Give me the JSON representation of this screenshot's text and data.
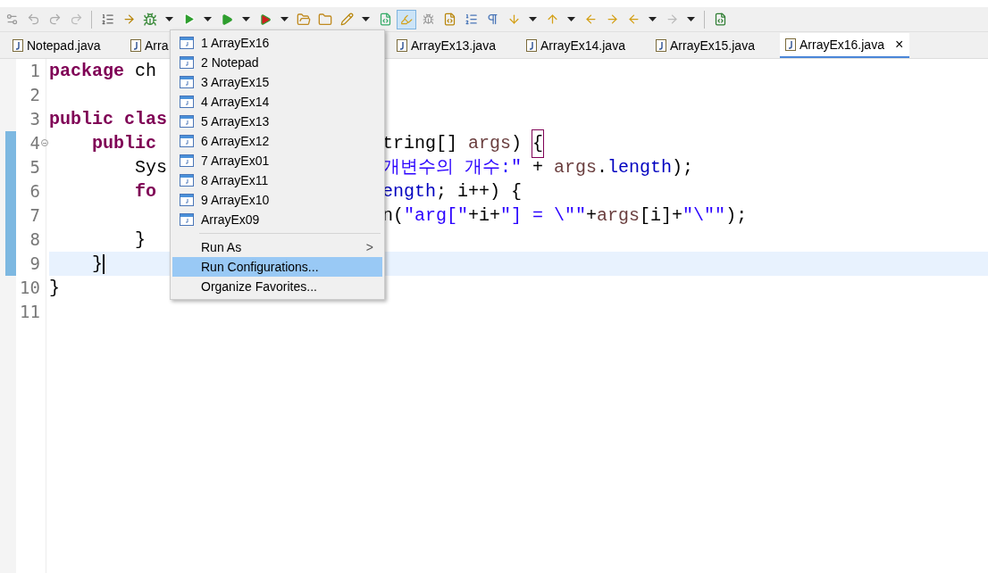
{
  "tabs": [
    {
      "label": "Notepad.java",
      "selected": false
    },
    {
      "label": "Arra",
      "selected": false
    },
    {
      "label": "ArrayEx13.java",
      "selected": false
    },
    {
      "label": "ArrayEx14.java",
      "selected": false
    },
    {
      "label": "ArrayEx15.java",
      "selected": false
    },
    {
      "label": "ArrayEx16.java",
      "selected": true,
      "close": "×"
    }
  ],
  "editor": {
    "lines": [
      {
        "number": "1",
        "marked": false,
        "current": false,
        "foldable": false,
        "left": [
          {
            "kind": "keyword",
            "text": "package"
          },
          {
            "kind": "plain",
            "text": " ch"
          }
        ]
      },
      {
        "number": "2",
        "marked": false,
        "current": false,
        "foldable": false
      },
      {
        "number": "3",
        "marked": false,
        "current": false,
        "foldable": false,
        "left": [
          {
            "kind": "keyword",
            "text": "public "
          },
          {
            "kind": "keyword",
            "text": "clas"
          }
        ]
      },
      {
        "number": "4",
        "marked": true,
        "current": false,
        "foldable": true,
        "left": [
          {
            "kind": "keyword",
            "text": "    public"
          }
        ],
        "right": [
          {
            "kind": "plain",
            "text": "tring[] "
          },
          {
            "kind": "variable",
            "text": "args"
          },
          {
            "kind": "plain",
            "text": ") "
          },
          {
            "kind": "plain",
            "text": "{",
            "boxed": true
          }
        ]
      },
      {
        "number": "5",
        "marked": true,
        "current": false,
        "foldable": false,
        "left": [
          {
            "kind": "plain",
            "text": "        Sys"
          }
        ],
        "right": [
          {
            "kind": "string",
            "text": "개변수의 개수:\""
          },
          {
            "kind": "plain",
            "text": " + "
          },
          {
            "kind": "variable",
            "text": "args"
          },
          {
            "kind": "plain",
            "text": "."
          },
          {
            "kind": "field",
            "text": "length"
          },
          {
            "kind": "plain",
            "text": ");"
          }
        ]
      },
      {
        "number": "6",
        "marked": true,
        "current": false,
        "foldable": false,
        "left": [
          {
            "kind": "keyword",
            "text": "        fo"
          }
        ],
        "right": [
          {
            "kind": "field",
            "text": "ength"
          },
          {
            "kind": "plain",
            "text": "; i++) {"
          }
        ]
      },
      {
        "number": "7",
        "marked": true,
        "current": false,
        "foldable": false,
        "right": [
          {
            "kind": "plain",
            "text": "n("
          },
          {
            "kind": "string",
            "text": "\"arg[\""
          },
          {
            "kind": "plain",
            "text": "+i+"
          },
          {
            "kind": "string",
            "text": "\"] = \\\"\""
          },
          {
            "kind": "plain",
            "text": "+"
          },
          {
            "kind": "variable",
            "text": "args"
          },
          {
            "kind": "plain",
            "text": "[i]+"
          },
          {
            "kind": "string",
            "text": "\"\\\"\""
          },
          {
            "kind": "plain",
            "text": ");"
          }
        ]
      },
      {
        "number": "8",
        "marked": true,
        "current": false,
        "foldable": false,
        "left": [
          {
            "kind": "plain",
            "text": "        }"
          }
        ]
      },
      {
        "number": "9",
        "marked": true,
        "current": true,
        "foldable": false,
        "left": [
          {
            "kind": "plain",
            "text": "    }"
          }
        ]
      },
      {
        "number": "10",
        "marked": false,
        "current": false,
        "foldable": false,
        "left": [
          {
            "kind": "plain",
            "text": "}"
          }
        ]
      },
      {
        "number": "11",
        "marked": false,
        "current": false,
        "foldable": false
      }
    ]
  },
  "menu": {
    "items": [
      {
        "kind": "launch",
        "label": "1 ArrayEx16",
        "selected": false
      },
      {
        "kind": "launch",
        "label": "2 Notepad",
        "selected": false
      },
      {
        "kind": "launch",
        "label": "3 ArrayEx15",
        "selected": false
      },
      {
        "kind": "launch",
        "label": "4 ArrayEx14",
        "selected": false
      },
      {
        "kind": "launch",
        "label": "5 ArrayEx13",
        "selected": false
      },
      {
        "kind": "launch",
        "label": "6 ArrayEx12",
        "selected": false
      },
      {
        "kind": "launch",
        "label": "7 ArrayEx01",
        "selected": false
      },
      {
        "kind": "launch",
        "label": "8 ArrayEx11",
        "selected": false
      },
      {
        "kind": "launch",
        "label": "9 ArrayEx10",
        "selected": false
      },
      {
        "kind": "launch",
        "label": "ArrayEx09",
        "selected": false
      },
      {
        "kind": "separator"
      },
      {
        "kind": "submenu",
        "label": "Run As",
        "arrow": ">",
        "selected": false
      },
      {
        "kind": "action",
        "label": "Run Configurations...",
        "selected": true
      },
      {
        "kind": "action",
        "label": "Organize Favorites...",
        "selected": false
      }
    ]
  }
}
